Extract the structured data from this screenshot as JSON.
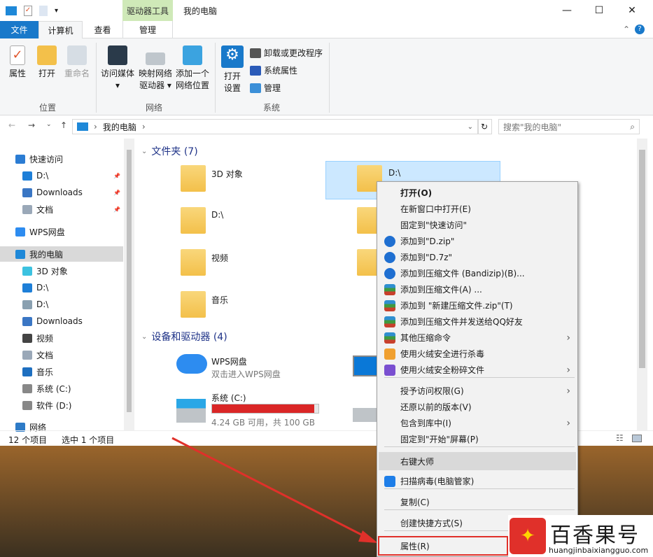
{
  "window": {
    "title": "我的电脑",
    "context_tab": "驱动器工具",
    "controls": {
      "minimize": "—",
      "maximize": "☐",
      "close": "✕"
    }
  },
  "tabs": [
    {
      "label": "文件"
    },
    {
      "label": "计算机"
    },
    {
      "label": "查看"
    },
    {
      "label": "管理"
    }
  ],
  "ribbon": {
    "location": {
      "name": "位置",
      "items": [
        "属性",
        "打开",
        "重命名"
      ]
    },
    "network": {
      "name": "网络",
      "items": [
        {
          "line1": "访问媒体",
          "line2": "▾"
        },
        {
          "line1": "映射网络",
          "line2": "驱动器 ▾"
        },
        {
          "line1": "添加一个",
          "line2": "网络位置"
        }
      ]
    },
    "system": {
      "name": "系统",
      "open_settings": {
        "line1": "打开",
        "line2": "设置"
      },
      "small": [
        "卸载或更改程序",
        "系统属性",
        "管理"
      ]
    }
  },
  "address": {
    "path": "我的电脑",
    "search_placeholder": "搜索\"我的电脑\""
  },
  "nav": {
    "items": [
      {
        "label": "快速访问",
        "icon": "star-icon",
        "color": "#2b7cd3"
      },
      {
        "label": "D:\\",
        "icon": "monitor-icon",
        "color": "#1e7fd8",
        "pinned": true
      },
      {
        "label": "Downloads",
        "icon": "download-arrow-icon",
        "color": "#3a76c4",
        "pinned": true
      },
      {
        "label": "文档",
        "icon": "document-icon",
        "color": "#9aa8b8",
        "pinned": true
      },
      {
        "label": "WPS网盘",
        "icon": "cloud-icon",
        "color": "#2d8cf0"
      },
      {
        "label": "我的电脑",
        "icon": "computer-icon",
        "color": "#1e88d8",
        "selected": true
      },
      {
        "label": "3D 对象",
        "icon": "cube-icon",
        "color": "#3cc2e0"
      },
      {
        "label": "D:\\",
        "icon": "monitor-icon",
        "color": "#1e7fd8"
      },
      {
        "label": "D:\\",
        "icon": "picture-icon",
        "color": "#8aa0b0"
      },
      {
        "label": "Downloads",
        "icon": "download-arrow-icon",
        "color": "#3a76c4"
      },
      {
        "label": "视频",
        "icon": "film-icon",
        "color": "#444"
      },
      {
        "label": "文档",
        "icon": "document-icon",
        "color": "#9aa8b8"
      },
      {
        "label": "音乐",
        "icon": "music-note-icon",
        "color": "#1e6fc0"
      },
      {
        "label": "系统 (C:)",
        "icon": "drive-icon",
        "color": "#888"
      },
      {
        "label": "软件 (D:)",
        "icon": "drive-icon",
        "color": "#888"
      },
      {
        "label": "网络",
        "icon": "network-icon",
        "color": "#2e7bc7"
      }
    ]
  },
  "content": {
    "folders_header": "文件夹 (7)",
    "folders": [
      {
        "label": "3D 对象"
      },
      {
        "label": "D:\\",
        "selected": true
      },
      {
        "label": "D:\\"
      },
      {
        "label": "视频"
      },
      {
        "label": "音乐"
      }
    ],
    "devices_header": "设备和驱动器 (4)",
    "wps": {
      "label": "WPS网盘",
      "sub": "双击进入WPS网盘"
    },
    "drive_c": {
      "label": "系统 (C:)",
      "free": "4.24 GB 可用，共 100 GB",
      "used_fraction": 0.958,
      "bar_color": "#da2626"
    }
  },
  "status": {
    "count": "12 个项目",
    "selected": "选中 1 个项目"
  },
  "context_menu": {
    "items": [
      {
        "label": "打开(O)",
        "bold": true
      },
      {
        "label": "在新窗口中打开(E)"
      },
      {
        "label": "固定到\"快速访问\""
      },
      {
        "label": "添加到\"D.zip\"",
        "icon": "bandizip-icon"
      },
      {
        "label": "添加到\"D.7z\"",
        "icon": "bandizip-icon"
      },
      {
        "label": "添加到压缩文件 (Bandizip)(B)...",
        "icon": "bandizip-icon"
      },
      {
        "label": "添加到压缩文件(A) ...",
        "icon": "winrar-icon"
      },
      {
        "label": "添加到 \"新建压缩文件.zip\"(T)",
        "icon": "winrar-icon"
      },
      {
        "label": "添加到压缩文件并发送给QQ好友",
        "icon": "winrar-icon"
      },
      {
        "label": "其他压缩命令",
        "icon": "winrar-icon",
        "submenu": true
      },
      {
        "label": "使用火绒安全进行杀毒",
        "icon": "huorong-shield-icon"
      },
      {
        "label": "使用火绒安全粉碎文件",
        "icon": "shredder-icon",
        "submenu": true
      },
      {
        "label": "授予访问权限(G)",
        "submenu": true
      },
      {
        "label": "还原以前的版本(V)"
      },
      {
        "label": "包含到库中(I)",
        "submenu": true
      },
      {
        "label": "固定到\"开始\"屏幕(P)"
      },
      {
        "label": "右键大师",
        "highlighted": true
      },
      {
        "label": "扫描病毒(电脑管家)",
        "icon": "tencent-guard-icon"
      },
      {
        "label": "复制(C)"
      },
      {
        "label": "创建快捷方式(S)"
      },
      {
        "label": "属性(R)",
        "annotated": true
      }
    ]
  },
  "watermark": {
    "name": "百香果号",
    "url": "huangjinbaixiangguo.com"
  },
  "colors": {
    "accent": "#1979ca",
    "annotation": "#e0302a",
    "selection": "#cce8ff"
  }
}
